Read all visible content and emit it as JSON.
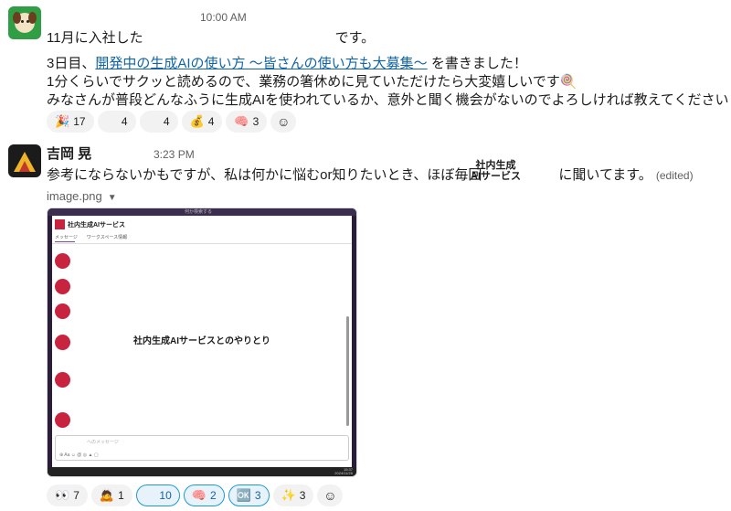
{
  "message1": {
    "time": "10:00 AM",
    "line1_prefix": "11月に入社した",
    "line1_suffix": "です。",
    "line2_prefix": "3日目、",
    "line2_link": "開発中の生成AIの使い方 〜皆さんの使い方も大募集〜",
    "line2_suffix": "を書きました！",
    "line3": "1分くらいでサクッと読めるので、業務の箸休めに見ていただけたら大変嬉しいです",
    "line3_emoji": "🍭",
    "line4": "みなさんが普段どんなふうに生成AIを使われているか、意外と聞く機会がないのでよろしければ教えてください",
    "line4_emoji": "🎄",
    "reactions": [
      {
        "emoji": "🎉",
        "count": "17"
      },
      {
        "emoji": "",
        "count": "4"
      },
      {
        "emoji": "",
        "count": "4"
      },
      {
        "emoji": "💰",
        "count": "4"
      },
      {
        "emoji": "🧠",
        "count": "3"
      }
    ]
  },
  "message2": {
    "author": "吉岡 晃",
    "time": "3:23 PM",
    "text_prefix": "参考にならないかもですが、私は何かに悩むor知りたいとき、ほぼ毎回",
    "badge_line1": "社内生成",
    "badge_line2": "AIサービス",
    "text_suffix": "に聞いてます。",
    "edited": "(edited)",
    "file_name": "image.png",
    "reactions": [
      {
        "emoji": "👀",
        "count": "7",
        "selected": false
      },
      {
        "emoji": "🙇",
        "count": "1",
        "selected": false
      },
      {
        "emoji": "",
        "count": "10",
        "selected": true
      },
      {
        "emoji": "🧠",
        "count": "2",
        "selected": true
      },
      {
        "emoji": "🆗",
        "count": "3",
        "selected": true
      },
      {
        "emoji": "✨",
        "count": "3",
        "selected": false
      }
    ]
  },
  "screenshot": {
    "window_title": "何か検索する",
    "channel_name": "社内生成AIサービス",
    "tab_messages": "メッセージ",
    "tab_workspace": "ワークスペース情報",
    "center_text": "社内生成AIサービスとのやりとり",
    "composer_placeholder": "へのメッセージ",
    "clock_time": "15:37",
    "clock_date": "2024/11/26"
  },
  "icons": {
    "add_reaction": "add-reaction-icon",
    "dropdown": "chevron-down-icon"
  }
}
